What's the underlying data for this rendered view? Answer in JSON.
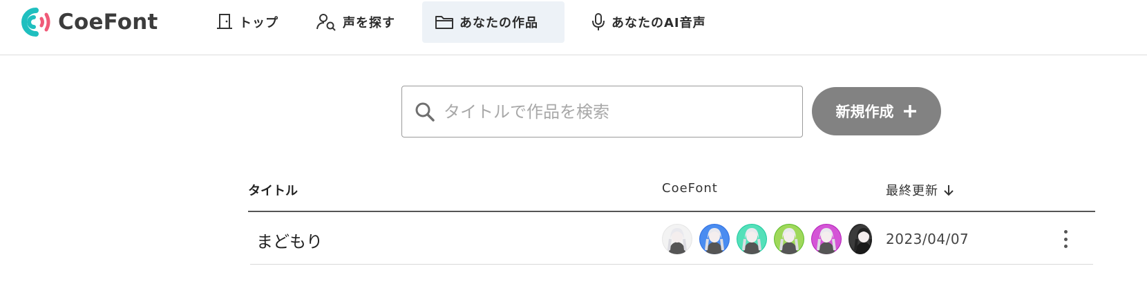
{
  "header": {
    "logo_text": "CoeFont",
    "nav": [
      {
        "label": "トップ",
        "icon": "door-icon",
        "active": false
      },
      {
        "label": "声を探す",
        "icon": "search-user-icon",
        "active": false
      },
      {
        "label": "あなたの作品",
        "icon": "folder-icon",
        "active": true
      },
      {
        "label": "あなたのAI音声",
        "icon": "microphone-icon",
        "active": false
      }
    ]
  },
  "search": {
    "placeholder": "タイトルで作品を検索",
    "value": "",
    "new_button_label": "新規作成"
  },
  "table": {
    "headers": {
      "title": "タイトル",
      "coefont": "CoeFont",
      "updated": "最終更新"
    },
    "sort": "descending",
    "rows": [
      {
        "title": "まどもり",
        "date": "2023/04/07",
        "avatars": [
          {
            "name": "avatar-1",
            "ring": "#e6e6e6",
            "bg": "#f3f3f3"
          },
          {
            "name": "avatar-2",
            "ring": "#2d6de0",
            "bg": "#4a8cf0"
          },
          {
            "name": "avatar-3",
            "ring": "#1fc9a0",
            "bg": "#54e0b9"
          },
          {
            "name": "avatar-4",
            "ring": "#5dbb2a",
            "bg": "#9fd85a"
          },
          {
            "name": "avatar-5",
            "ring": "#b421b9",
            "bg": "#d455d6"
          },
          {
            "name": "avatar-6",
            "ring": "#2a2a2a",
            "bg": "#3b3b3b"
          }
        ]
      }
    ]
  },
  "colors": {
    "brand_teal": "#1fbfbf",
    "brand_pink": "#f05a78",
    "active_nav_bg": "#edf2f7",
    "button_bg": "#828282"
  }
}
